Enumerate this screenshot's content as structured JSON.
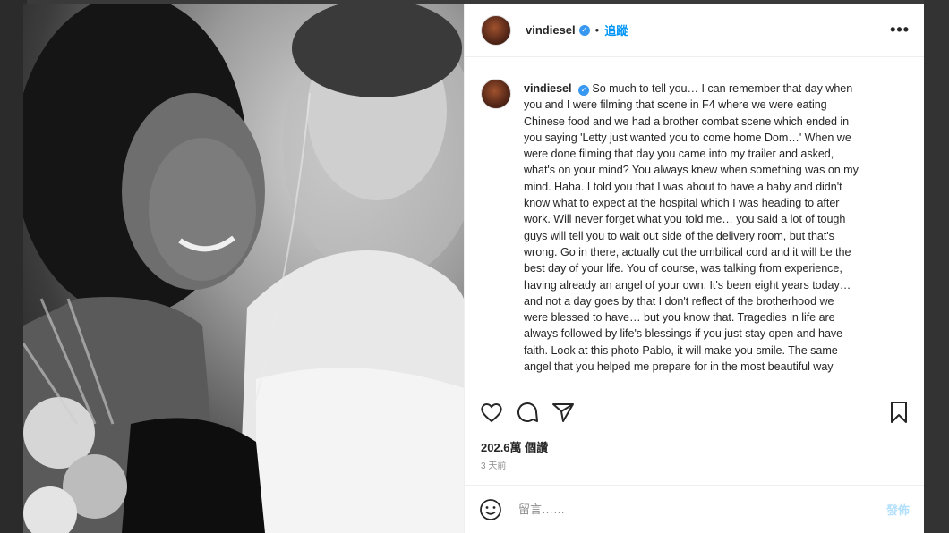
{
  "post": {
    "username": "vindiesel",
    "follow_label": "追蹤",
    "separator": "•",
    "more_label": "•••"
  },
  "caption": {
    "username": "vindiesel",
    "text": "So much to tell you… I can remember that day when\nyou and I were filming that scene in F4 where we were eating\nChinese food and we had a brother combat scene which ended in\nyou saying 'Letty just wanted you to come home Dom…' When we\nwere done filming that day you came into my trailer and asked,\nwhat's on your mind? You always knew when something was on my\nmind. Haha. I told you that I was about to have a baby and didn't\nknow what to expect at the hospital which I was heading to after\nwork. Will never forget what you told me… you said a lot of tough\nguys will tell you to wait out side of the delivery room, but that's\nwrong. Go in there, actually cut the umbilical cord and it will be the\nbest day of your life. You of course, was talking from experience,\nhaving already an angel of your own. It's been eight years today…\nand not a day goes by that I don't reflect of the brotherhood we\nwere blessed to have… but you know that. Tragedies in life are\nalways followed by life's blessings if you just stay open and have\nfaith. Look at this photo Pablo, it will make you smile. The same\nangel that you helped me prepare for in the most beautiful way"
  },
  "stats": {
    "likes": "202.6萬 個讚",
    "time": "3 天前"
  },
  "comment": {
    "placeholder": "留言……",
    "post_label": "發佈"
  },
  "icons": {
    "like": "heart-icon",
    "comment": "comment-icon",
    "share": "paper-plane-icon",
    "save": "bookmark-icon",
    "emoji": "smiley-icon",
    "verified": "verified-badge-icon"
  },
  "colors": {
    "link_blue": "#0095f6",
    "verified_blue": "#3897f0",
    "post_disabled": "#b2dffc",
    "muted": "#8e8e8e"
  }
}
